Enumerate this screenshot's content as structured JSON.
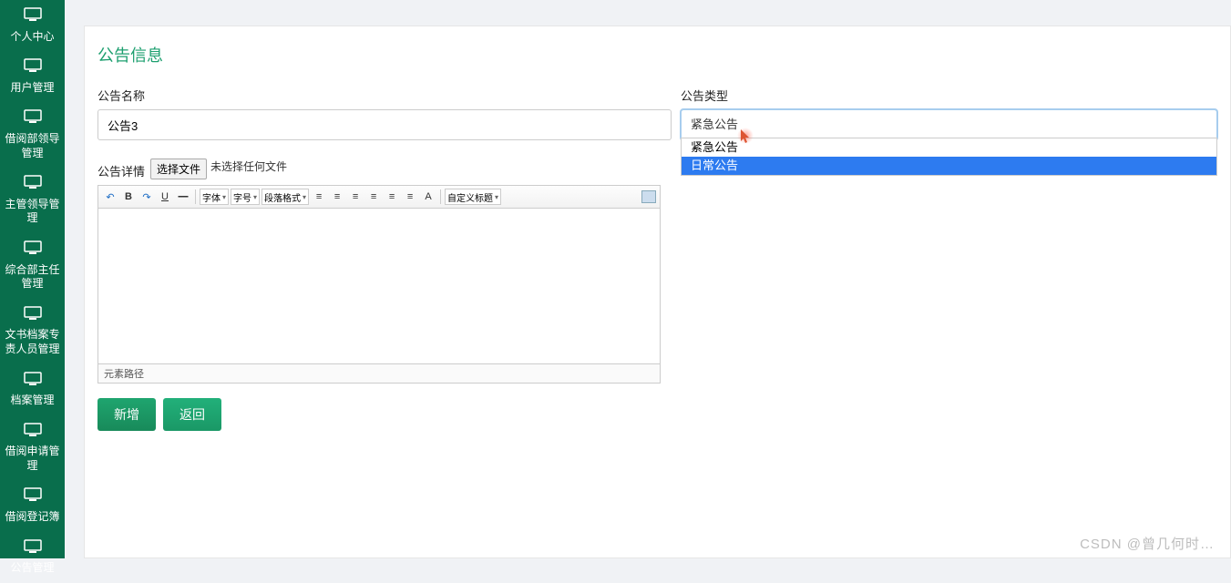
{
  "sidebar": {
    "items": [
      {
        "label": "个人中心"
      },
      {
        "label": "用户管理"
      },
      {
        "label": "借阅部领导管理"
      },
      {
        "label": "主管领导管理"
      },
      {
        "label": "综合部主任管理"
      },
      {
        "label": "文书档案专责人员管理"
      },
      {
        "label": "档案管理"
      },
      {
        "label": "借阅申请管理"
      },
      {
        "label": "借阅登记簿"
      },
      {
        "label": "公告管理"
      }
    ]
  },
  "page": {
    "title": "公告信息"
  },
  "form": {
    "name_label": "公告名称",
    "name_value": "公告3",
    "type_label": "公告类型",
    "type_value": "紧急公告",
    "type_options": [
      "紧急公告",
      "日常公告"
    ],
    "detail_label": "公告详情",
    "file_btn": "选择文件",
    "file_status": "未选择任何文件"
  },
  "editor": {
    "font_label": "字体",
    "size_label": "字号",
    "para_label": "段落格式",
    "custom_label": "自定义标题",
    "footer": "元素路径"
  },
  "buttons": {
    "add": "新增",
    "back": "返回"
  },
  "watermark": "CSDN @曾几何时…"
}
